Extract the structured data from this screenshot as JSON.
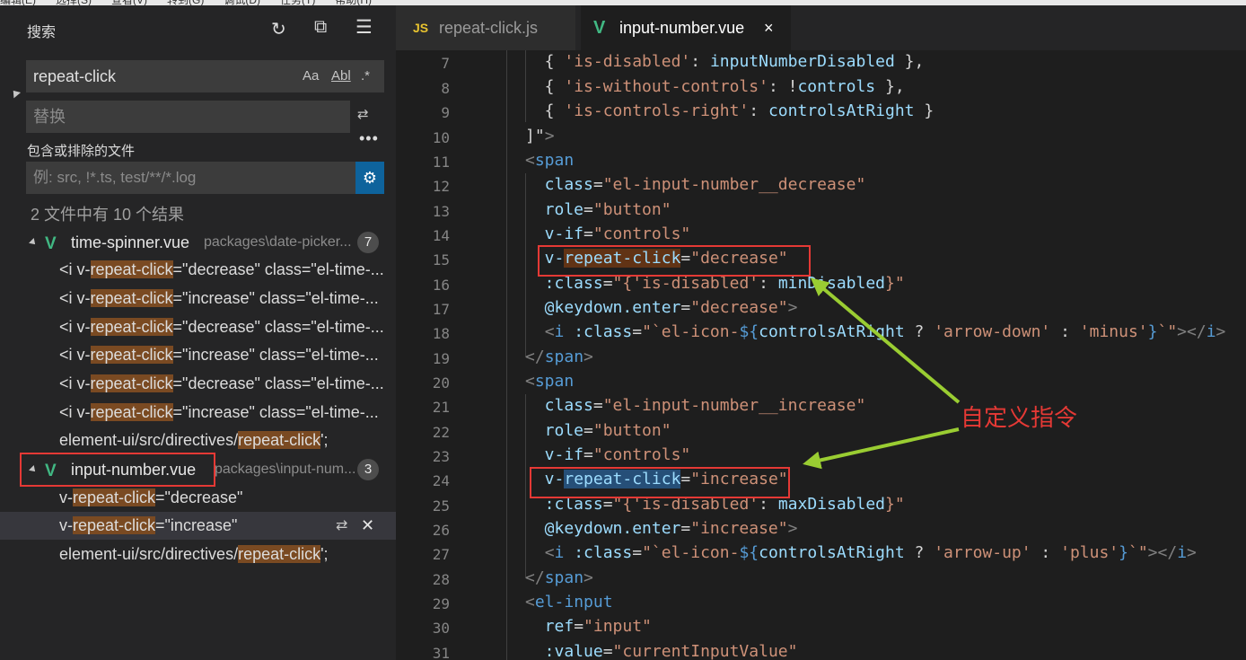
{
  "menu_bar": {
    "items": [
      "编辑(E)",
      "选择(S)",
      "查看(V)",
      "转到(G)",
      "调试(D)",
      "任务(T)",
      "帮助(H)"
    ]
  },
  "sidebar": {
    "title": "搜索",
    "actions": {
      "refresh_icon": "refresh-icon",
      "collapse_all_icon": "collapse-all-icon",
      "clear_icon": "clear-results-icon"
    },
    "search": {
      "value": "repeat-click",
      "options": [
        "Aa",
        "Abl",
        ".*"
      ]
    },
    "replace": {
      "placeholder": "替换"
    },
    "files_label": "包含或排除的文件",
    "exclude": {
      "placeholder": "例: src, !*.ts, test/**/*.log"
    },
    "summary": "2 文件中有 10 个结果",
    "files": [
      {
        "name": "time-spinner.vue",
        "path": "packages\\date-picker...",
        "count": "7",
        "matches": [
          {
            "pre": "<i v-",
            "hit": "repeat-click",
            "post": "=\"decrease\" class=\"el-time-..."
          },
          {
            "pre": "<i v-",
            "hit": "repeat-click",
            "post": "=\"increase\" class=\"el-time-..."
          },
          {
            "pre": "<i v-",
            "hit": "repeat-click",
            "post": "=\"decrease\" class=\"el-time-..."
          },
          {
            "pre": "<i v-",
            "hit": "repeat-click",
            "post": "=\"increase\" class=\"el-time-..."
          },
          {
            "pre": "<i v-",
            "hit": "repeat-click",
            "post": "=\"decrease\" class=\"el-time-..."
          },
          {
            "pre": "<i v-",
            "hit": "repeat-click",
            "post": "=\"increase\" class=\"el-time-..."
          },
          {
            "pre": "element-ui/src/directives/",
            "hit": "repeat-click",
            "post": "';"
          }
        ]
      },
      {
        "name": "input-number.vue",
        "path": "packages\\input-num...",
        "count": "3",
        "matches": [
          {
            "pre": "v-",
            "hit": "repeat-click",
            "post": "=\"decrease\""
          },
          {
            "pre": "v-",
            "hit": "repeat-click",
            "post": "=\"increase\""
          },
          {
            "pre": "element-ui/src/directives/",
            "hit": "repeat-click",
            "post": "';"
          }
        ]
      }
    ]
  },
  "tabs": [
    {
      "icon": "JS",
      "label": "repeat-click.js",
      "active": false
    },
    {
      "icon": "V",
      "label": "input-number.vue",
      "active": true,
      "close": "×"
    }
  ],
  "editor": {
    "line_numbers": [
      "7",
      "8",
      "9",
      "10",
      "11",
      "12",
      "13",
      "14",
      "15",
      "16",
      "17",
      "18",
      "19",
      "20",
      "21",
      "22",
      "23",
      "24",
      "25",
      "26",
      "27",
      "28",
      "29",
      "30",
      "31"
    ]
  },
  "annotation": "自定义指令",
  "colors": {
    "highlight": "#7a4a22",
    "annotation_red": "#e53935",
    "arrow_green": "#9acd32",
    "vue_green": "#41b883"
  }
}
